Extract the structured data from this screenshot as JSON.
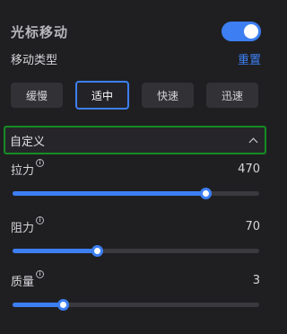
{
  "colors": {
    "accent": "#3d7ff2",
    "custom_border": "#178c23",
    "background": "#1f1f22"
  },
  "header": {
    "title": "光标移动",
    "toggle_on": true
  },
  "move_type": {
    "label": "移动类型",
    "reset": "重置"
  },
  "modes": [
    {
      "label": "缓慢",
      "active": false
    },
    {
      "label": "适中",
      "active": true
    },
    {
      "label": "快速",
      "active": false
    },
    {
      "label": "迅速",
      "active": false
    }
  ],
  "custom": {
    "label": "自定义",
    "expanded": true,
    "icon": "chevron-up-icon"
  },
  "sliders": [
    {
      "label": "拉力",
      "value": "470",
      "fraction": 0.78
    },
    {
      "label": "阻力",
      "value": "70",
      "fraction": 0.34
    },
    {
      "label": "质量",
      "value": "3",
      "fraction": 0.205
    }
  ]
}
